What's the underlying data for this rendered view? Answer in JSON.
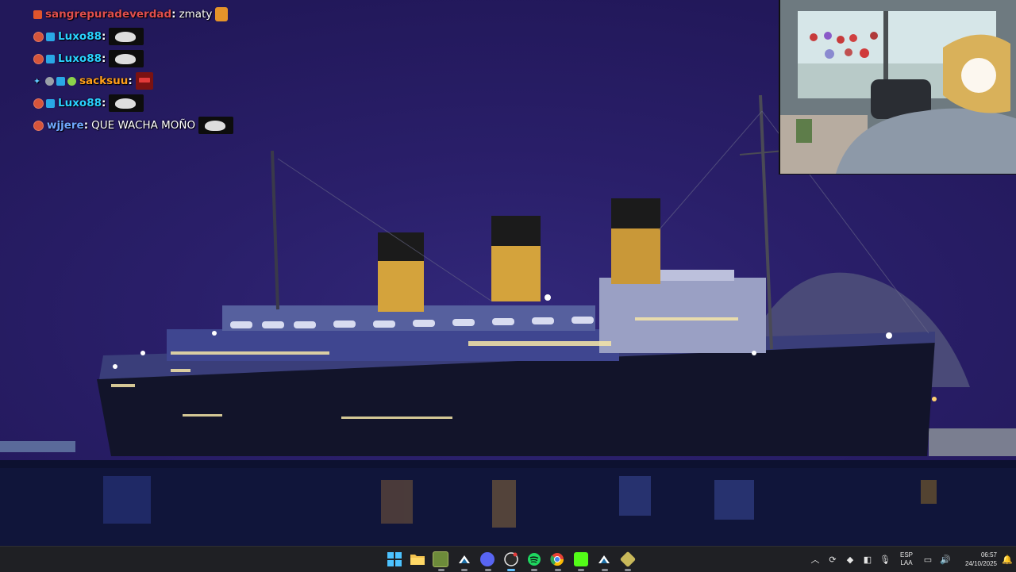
{
  "chat": {
    "lines": [
      {
        "username": "sangrepuradeverdad",
        "message": "zmaty",
        "color": "#e04e4e"
      },
      {
        "username": "Luxo88",
        "message": "",
        "color": "#2ad1ff"
      },
      {
        "username": "Luxo88",
        "message": "",
        "color": "#2ad1ff"
      },
      {
        "username": "sacksuu",
        "message": "",
        "color": "#ff9f1a"
      },
      {
        "username": "Luxo88",
        "message": "",
        "color": "#2ad1ff"
      },
      {
        "username": "wjjere",
        "message": "QUE WACHA MOÑO",
        "color": "#6fa8ff"
      }
    ]
  },
  "taskbar": {
    "apps": [
      {
        "name": "start-icon",
        "color": "#4cc2ff"
      },
      {
        "name": "file-explorer-icon",
        "color": "#f2c14e"
      },
      {
        "name": "minecraft-launcher-icon",
        "color": "#6d8b3a"
      },
      {
        "name": "steam-icon",
        "color": "#1b6fa8"
      },
      {
        "name": "discord-icon",
        "color": "#5865f2"
      },
      {
        "name": "obs-icon",
        "color": "#3a3a3a"
      },
      {
        "name": "spotify-icon",
        "color": "#1ed760"
      },
      {
        "name": "chrome-icon",
        "color": "#e94235"
      },
      {
        "name": "kick-icon",
        "color": "#53fc18"
      },
      {
        "name": "steam-icon-2",
        "color": "#1b6fa8"
      },
      {
        "name": "game-icon",
        "color": "#c8b85a"
      }
    ],
    "tray": {
      "language_line1": "ESP",
      "language_line2": "LAA",
      "time": "06:57",
      "date": "24/10/2025"
    }
  }
}
